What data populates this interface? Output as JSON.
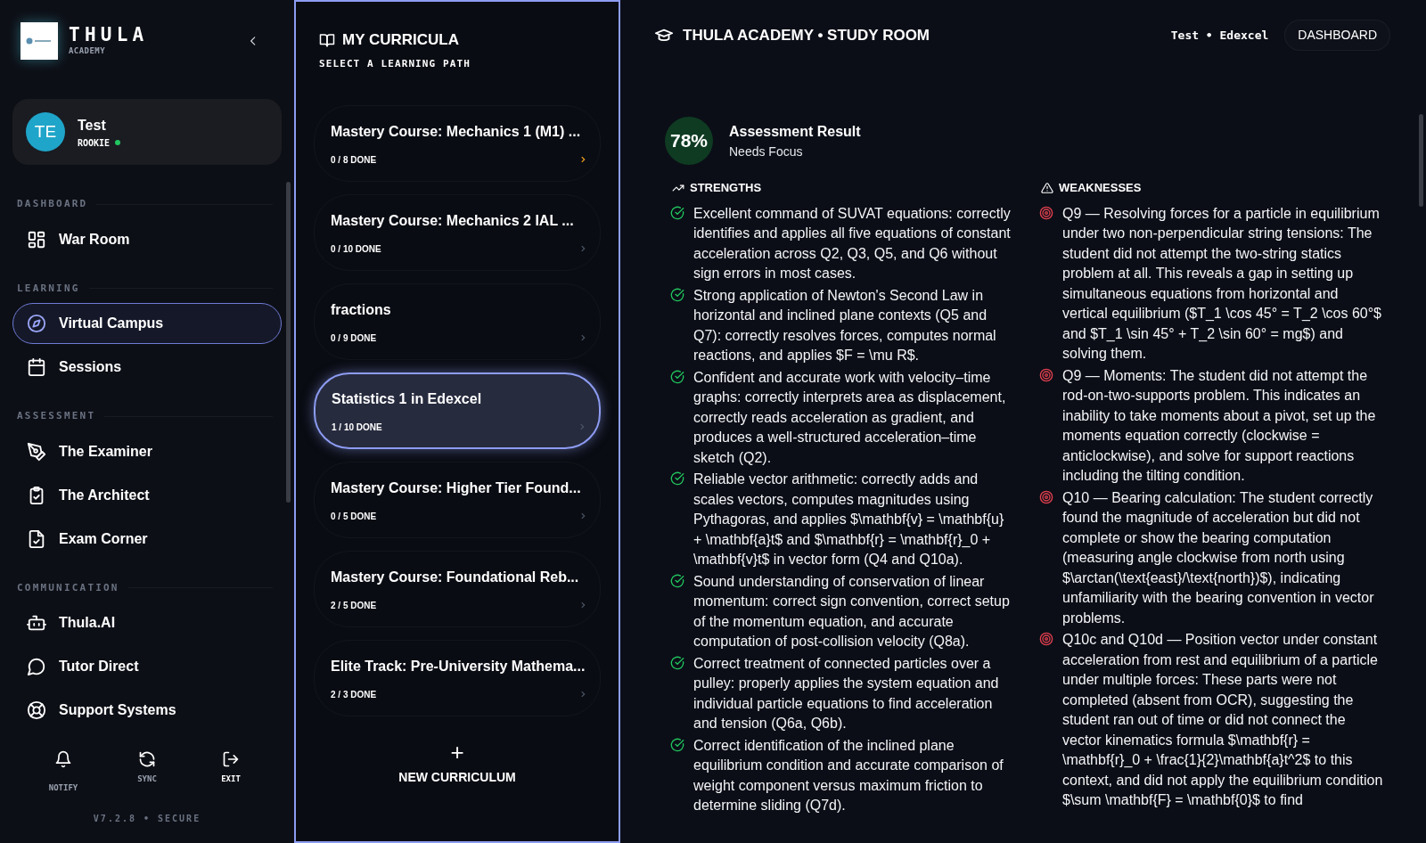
{
  "brand": {
    "name": "THULA",
    "sub": "ACADEMY"
  },
  "profile": {
    "initials": "TE",
    "name": "Test",
    "rank": "ROOKIE",
    "online": true
  },
  "nav": [
    {
      "heading": "DASHBOARD",
      "items": [
        {
          "label": "War Room",
          "selected": false
        }
      ]
    },
    {
      "heading": "LEARNING",
      "items": [
        {
          "label": "Virtual Campus",
          "selected": true
        },
        {
          "label": "Sessions",
          "selected": false
        }
      ]
    },
    {
      "heading": "ASSESSMENT",
      "items": [
        {
          "label": "The Examiner",
          "selected": false
        },
        {
          "label": "The Architect",
          "selected": false
        },
        {
          "label": "Exam Corner",
          "selected": false
        }
      ]
    },
    {
      "heading": "COMMUNICATION",
      "items": [
        {
          "label": "Thula.AI",
          "selected": false
        },
        {
          "label": "Tutor Direct",
          "selected": false
        },
        {
          "label": "Support Systems",
          "selected": false
        }
      ]
    }
  ],
  "footer_actions": [
    {
      "label": "NOTIFY"
    },
    {
      "label": "SYNC"
    },
    {
      "label": "EXIT"
    }
  ],
  "version": "V7.2.8 • SECURE",
  "curricula": {
    "title": "MY CURRICULA",
    "subtitle": "SELECT A LEARNING PATH",
    "items": [
      {
        "title": "Mastery Course: Mechanics 1 (M1) ...",
        "progress": "0 / 8 DONE",
        "selected": false,
        "hovered": true
      },
      {
        "title": "Mastery Course: Mechanics 2 IAL ...",
        "progress": "0 / 10 DONE",
        "selected": false,
        "hovered": false
      },
      {
        "title": "fractions",
        "progress": "0 / 9 DONE",
        "selected": false,
        "hovered": false
      },
      {
        "title": "Statistics 1 in Edexcel",
        "progress": "1 / 10 DONE",
        "selected": true,
        "hovered": false
      },
      {
        "title": "Mastery Course: Higher Tier Found...",
        "progress": "0 / 5 DONE",
        "selected": false,
        "hovered": false
      },
      {
        "title": "Mastery Course: Foundational Reb...",
        "progress": "2 / 5 DONE",
        "selected": false,
        "hovered": false
      },
      {
        "title": "Elite Track: Pre-University Mathema...",
        "progress": "2 / 3 DONE",
        "selected": false,
        "hovered": false
      }
    ],
    "new_button": {
      "icon": "+",
      "label": "NEW CURRICULUM"
    }
  },
  "header": {
    "title": "THULA ACADEMY • STUDY ROOM",
    "context": "Test • Edexcel",
    "button": "DASHBOARD"
  },
  "result": {
    "score": "78%",
    "title": "Assessment Result",
    "verdict": "Needs Focus"
  },
  "strengths": {
    "heading": "STRENGTHS",
    "items": [
      "Excellent command of SUVAT equations: correctly identifies and applies all five equations of constant acceleration across Q2, Q3, Q5, and Q6 without sign errors in most cases.",
      "Strong application of Newton's Second Law in horizontal and inclined plane contexts (Q5 and Q7): correctly resolves forces, computes normal reactions, and applies $F = \\mu R$.",
      "Confident and accurate work with velocity–time graphs: correctly interprets area as displacement, correctly reads acceleration as gradient, and produces a well-structured acceleration–time sketch (Q2).",
      "Reliable vector arithmetic: correctly adds and scales vectors, computes magnitudes using Pythagoras, and applies $\\mathbf{v} = \\mathbf{u} + \\mathbf{a}t$ and $\\mathbf{r} = \\mathbf{r}_0 + \\mathbf{v}t$ in vector form (Q4 and Q10a).",
      "Sound understanding of conservation of linear momentum: correct sign convention, correct setup of the momentum equation, and accurate computation of post-collision velocity (Q8a).",
      "Correct treatment of connected particles over a pulley: properly applies the system equation and individual particle equations to find acceleration and tension (Q6a, Q6b).",
      "Correct identification of the inclined plane equilibrium condition and accurate comparison of weight component versus maximum friction to determine sliding (Q7d)."
    ]
  },
  "weaknesses": {
    "heading": "WEAKNESSES",
    "items": [
      "Q9 — Resolving forces for a particle in equilibrium under two non-perpendicular string tensions: The student did not attempt the two-string statics problem at all. This reveals a gap in setting up simultaneous equations from horizontal and vertical equilibrium ($T_1 \\cos 45° = T_2 \\cos 60°$ and $T_1 \\sin 45° + T_2 \\sin 60° = mg$) and solving them.",
      "Q9 — Moments: The student did not attempt the rod-on-two-supports problem. This indicates an inability to take moments about a pivot, set up the moments equation correctly (clockwise = anticlockwise), and solve for support reactions including the tilting condition.",
      "Q10 — Bearing calculation: The student correctly found the magnitude of acceleration but did not complete or show the bearing computation (measuring angle clockwise from north using $\\arctan(\\text{east}/\\text{north})$), indicating unfamiliarity with the bearing convention in vector problems.",
      "Q10c and Q10d — Position vector under constant acceleration from rest and equilibrium of a particle under multiple forces: These parts were not completed (absent from OCR), suggesting the student ran out of time or did not connect the vector kinematics formula $\\mathbf{r} = \\mathbf{r}_0 + \\frac{1}{2}\\mathbf{a}t^2$ to this context, and did not apply the equilibrium condition $\\sum \\mathbf{F} = \\mathbf{0}$ to find"
    ]
  }
}
